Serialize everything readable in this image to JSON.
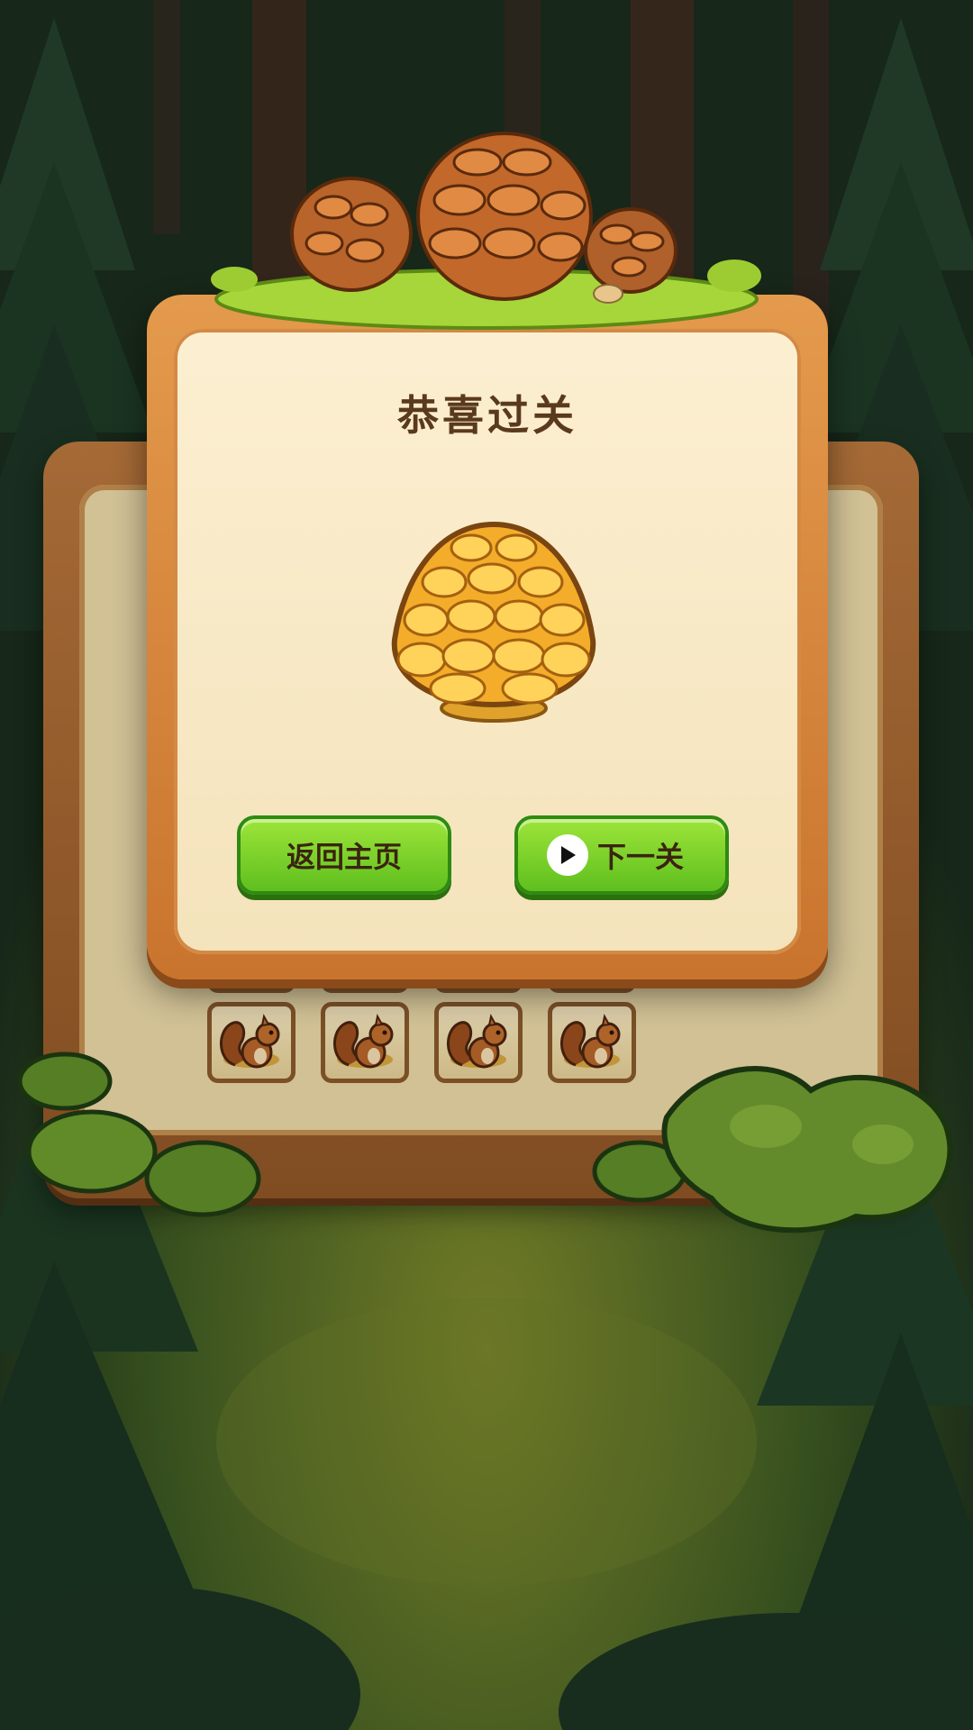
{
  "dialog": {
    "title": "恭喜过关",
    "home_button": "返回主页",
    "next_button": "下一关"
  },
  "icons": {
    "reward": "golden-pinecone-icon",
    "play": "play-icon",
    "tile": "squirrel-icon"
  },
  "colors": {
    "button_green": "#7ed22a",
    "frame_orange": "#d6843a",
    "panel_cream": "#f8e9c6",
    "title_brown": "#5a3a1c"
  }
}
